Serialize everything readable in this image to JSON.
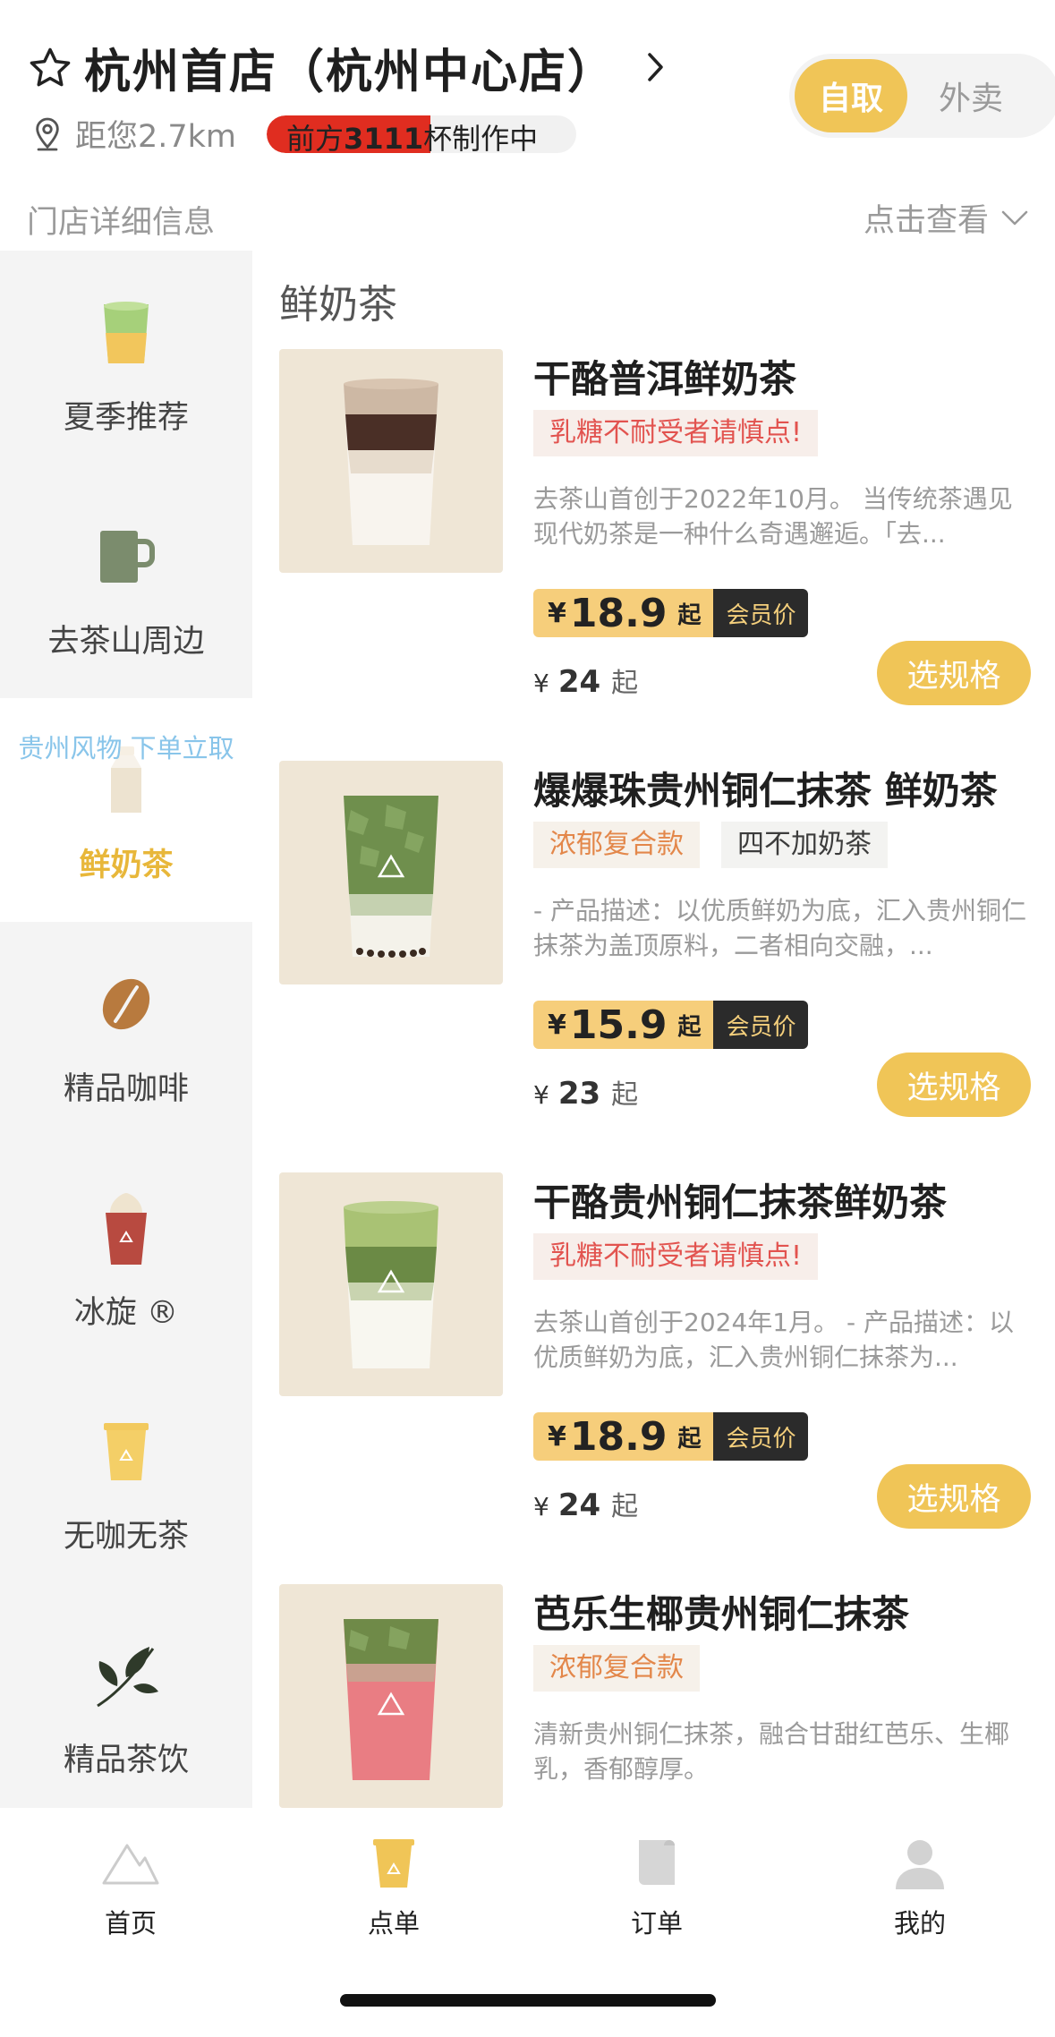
{
  "header": {
    "store_name": "杭州首店（杭州中心店）",
    "distance": "距您2.7km",
    "queue_prefix": "前方",
    "queue_count": "3111",
    "queue_suffix": "杯制作中",
    "queue_progress": 0.53,
    "mode_pickup": "自取",
    "mode_delivery": "外卖",
    "detail_label": "门店详细信息",
    "detail_link": "点击查看"
  },
  "sidebar": {
    "promo": "贵州风物 下单立取",
    "items": [
      {
        "label": "夏季推荐",
        "icon": "green-drink-cup-icon"
      },
      {
        "label": "去茶山周边",
        "icon": "mug-icon"
      },
      {
        "label": "鲜奶茶",
        "icon": "milk-bottle-icon"
      },
      {
        "label": "精品咖啡",
        "icon": "coffee-bean-icon"
      },
      {
        "label": "冰旋 ®",
        "icon": "ice-cream-cup-icon"
      },
      {
        "label": "无咖无茶",
        "icon": "yellow-cup-icon"
      },
      {
        "label": "精品茶饮",
        "icon": "tea-leaf-icon"
      }
    ]
  },
  "main": {
    "section_title": "鲜奶茶",
    "products": [
      {
        "name": "干酪普洱鲜奶茶",
        "tags": [
          {
            "text": "乳糖不耐受者请慎点!",
            "style": "red"
          }
        ],
        "desc": "去茶山首创于2022年10月。 当传统茶遇见现代奶茶是一种什么奇遇邂逅。「去...",
        "price_currency": "¥",
        "price": "18.9",
        "price_suffix": "起",
        "member_label": "会员价",
        "orig_currency": "¥",
        "orig_price": "24",
        "orig_suffix": "起",
        "button": "选规格"
      },
      {
        "name": "爆爆珠贵州铜仁抹茶 鲜奶茶",
        "tags": [
          {
            "text": "浓郁复合款",
            "style": "orange"
          },
          {
            "text": "四不加奶茶",
            "style": "dark"
          }
        ],
        "desc": "- 产品描述：以优质鲜奶为底，汇入贵州铜仁抹茶为盖顶原料，二者相向交融，...",
        "price_currency": "¥",
        "price": "15.9",
        "price_suffix": "起",
        "member_label": "会员价",
        "orig_currency": "¥",
        "orig_price": "23",
        "orig_suffix": "起",
        "button": "选规格"
      },
      {
        "name": "干酪贵州铜仁抹茶鲜奶茶",
        "tags": [
          {
            "text": "乳糖不耐受者请慎点!",
            "style": "red"
          }
        ],
        "desc": "去茶山首创于2024年1月。 - 产品描述：以优质鲜奶为底，汇入贵州铜仁抹茶为...",
        "price_currency": "¥",
        "price": "18.9",
        "price_suffix": "起",
        "member_label": "会员价",
        "orig_currency": "¥",
        "orig_price": "24",
        "orig_suffix": "起",
        "button": "选规格"
      },
      {
        "name": "芭乐生椰贵州铜仁抹茶",
        "tags": [
          {
            "text": "浓郁复合款",
            "style": "orange"
          }
        ],
        "desc": "清新贵州铜仁抹茶，融合甘甜红芭乐、生椰乳，香郁醇厚。"
      }
    ]
  },
  "tabbar": {
    "items": [
      {
        "label": "首页",
        "icon": "mountain-icon"
      },
      {
        "label": "点单",
        "icon": "cup-icon"
      },
      {
        "label": "订单",
        "icon": "receipt-icon"
      },
      {
        "label": "我的",
        "icon": "user-icon"
      }
    ]
  },
  "colors": {
    "accent": "#f0c557",
    "price_bg": "#f6ce7b",
    "queue_red": "#e02d20",
    "promo_blue": "#89c5ea"
  }
}
